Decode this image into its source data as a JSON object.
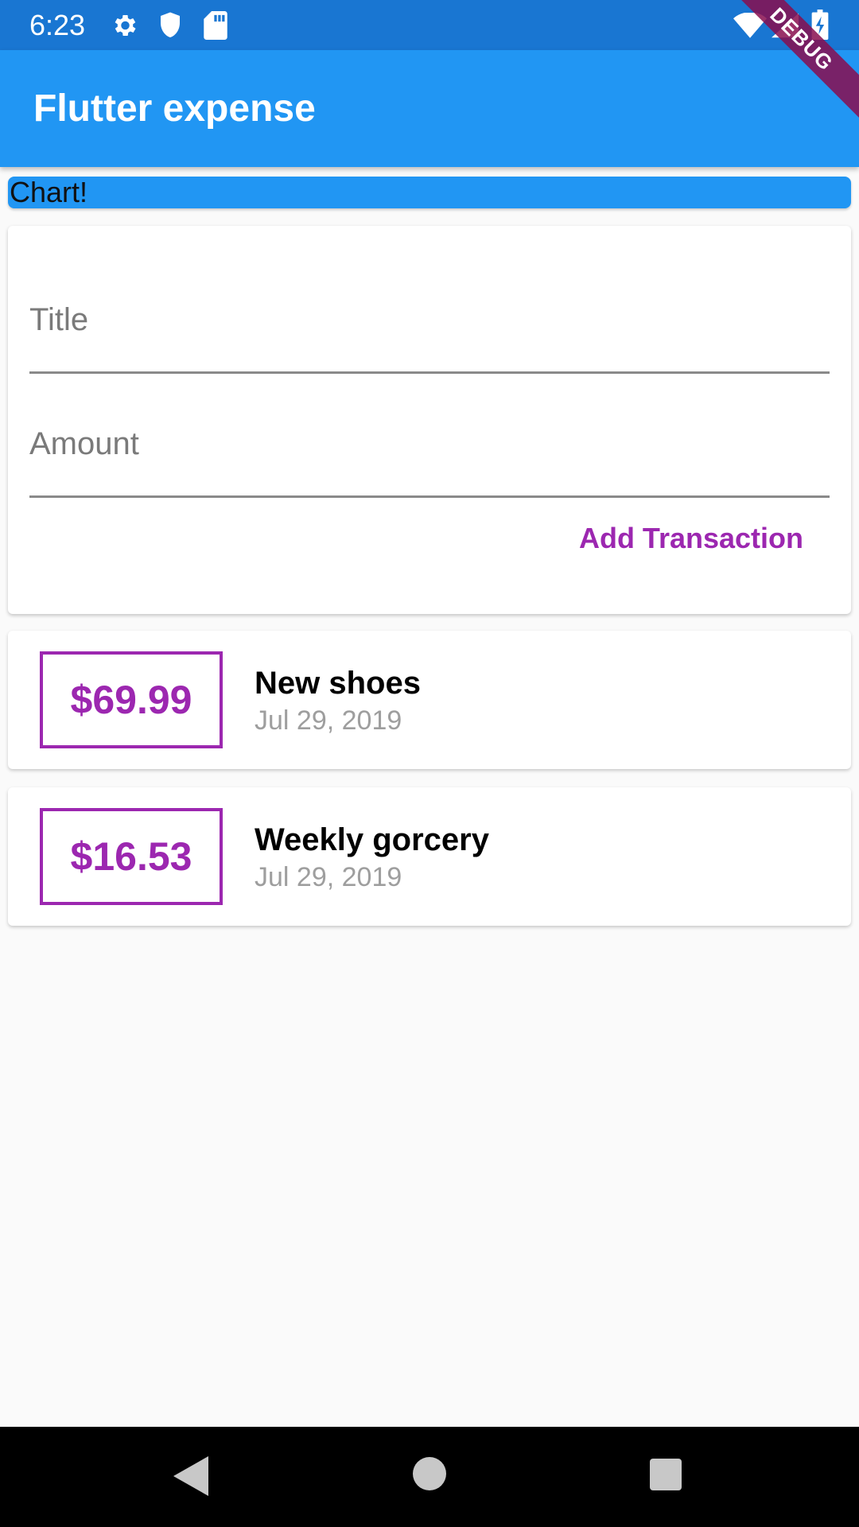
{
  "status_bar": {
    "time": "6:23",
    "icons": [
      "gear-icon",
      "shield-icon",
      "sd-card-icon",
      "wifi-icon",
      "signal-icon",
      "battery-charging-icon"
    ]
  },
  "app_bar": {
    "title": "Flutter expense"
  },
  "debug_banner": "DEBUG",
  "chart": {
    "label": "Chart!"
  },
  "form": {
    "title_placeholder": "Title",
    "amount_placeholder": "Amount",
    "submit_label": "Add Transaction"
  },
  "transactions": [
    {
      "amount": "$69.99",
      "title": "New shoes",
      "date": "Jul 29, 2019"
    },
    {
      "amount": "$16.53",
      "title": "Weekly gorcery",
      "date": "Jul 29, 2019"
    }
  ],
  "colors": {
    "primary": "#2196f3",
    "status_bar": "#1976d2",
    "accent": "#9c27b0",
    "background": "#fafafa"
  },
  "nav_bar": {
    "icons": [
      "back-icon",
      "home-icon",
      "recents-icon"
    ]
  }
}
